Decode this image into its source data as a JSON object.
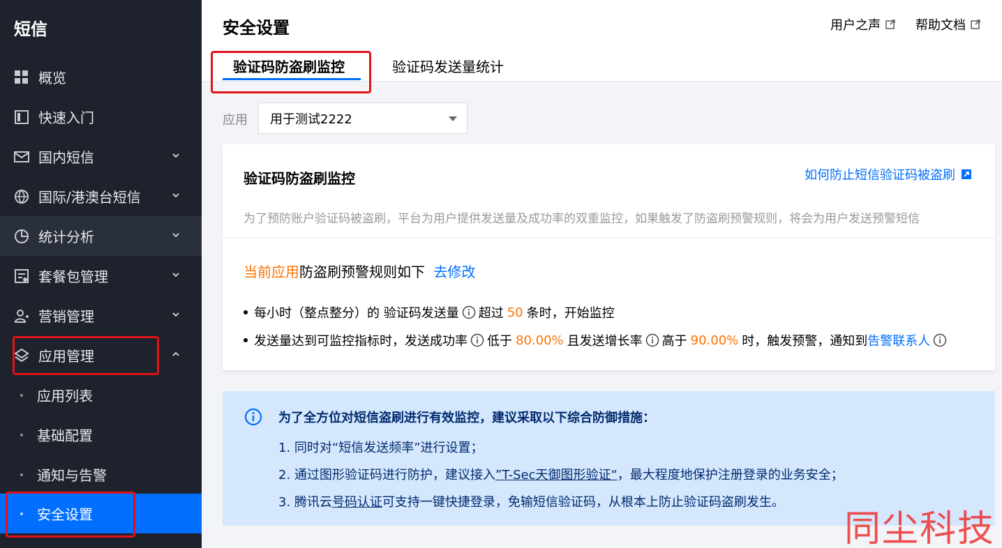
{
  "sidebar": {
    "title": "短信",
    "items": [
      {
        "label": "概览",
        "icon": "grid-icon",
        "has_chevron": false
      },
      {
        "label": "快速入门",
        "icon": "book-icon",
        "has_chevron": false
      },
      {
        "label": "国内短信",
        "icon": "mail-icon",
        "has_chevron": true
      },
      {
        "label": "国际/港澳台短信",
        "icon": "globe-icon",
        "has_chevron": true
      },
      {
        "label": "统计分析",
        "icon": "pie-chart-icon",
        "has_chevron": true
      },
      {
        "label": "套餐包管理",
        "icon": "package-icon",
        "has_chevron": true
      },
      {
        "label": "营销管理",
        "icon": "user-group-icon",
        "has_chevron": true
      },
      {
        "label": "应用管理",
        "icon": "layers-icon",
        "has_chevron": true,
        "expanded": true
      }
    ],
    "subitems": [
      {
        "label": "应用列表"
      },
      {
        "label": "基础配置"
      },
      {
        "label": "通知与告警"
      },
      {
        "label": "安全设置",
        "selected": true
      }
    ]
  },
  "header": {
    "title": "安全设置",
    "links": [
      "用户之声",
      "帮助文档"
    ],
    "tabs": [
      {
        "label": "验证码防盗刷监控",
        "active": true
      },
      {
        "label": "验证码发送量统计",
        "active": false
      }
    ]
  },
  "app_filter": {
    "label": "应用",
    "selected": "用于测试2222"
  },
  "card": {
    "title": "验证码防盗刷监控",
    "help_link": "如何防止短信验证码被盗刷",
    "description": "为了预防账户验证码被盗刷，平台为用户提供发送量及成功率的双重监控，如果触发了防盗刷预警规则，将会为用户发送预警短信",
    "rule_head_prefix": "当前应用",
    "rule_head_rest": "防盗刷预警规则如下",
    "rule_edit_link": "去修改",
    "rule1": {
      "text_a": "每小时（整点整分）的 验证码发送量",
      "text_b": "超过",
      "value": "50",
      "text_c": "条时，开始监控"
    },
    "rule2": {
      "text_a": "发送量达到可监控指标时，发送成功率",
      "text_b": "低于",
      "value1": "80.00%",
      "text_c": "且发送增长率",
      "text_d": "高于",
      "value2": "90.00%",
      "text_e": "时，触发预警，通知到",
      "link": "告警联系人"
    }
  },
  "notice": {
    "title": "为了全方位对短信盗刷进行有效监控，建议采取以下综合防御措施：",
    "line1": "1. 同时对“短信发送频率”进行设置；",
    "line2_a": "2. 通过图形验证码进行防护，建议接入",
    "line2_link": "”T-Sec天御图形验证“",
    "line2_b": "，最大程度地保护注册登录的业务安全；",
    "line3_a": "3. 腾讯云",
    "line3_link": "号码认证",
    "line3_b": "可支持一键快捷登录，免输短信验证码，从根本上防止验证码盗刷发生。"
  },
  "watermark": "同尘科技",
  "colors": {
    "sidebar_bg": "#1e222d",
    "primary": "#006eff",
    "highlight_orange": "#ff7200",
    "annotation_red": "#e1121b",
    "notice_bg": "#d5e7fd"
  }
}
